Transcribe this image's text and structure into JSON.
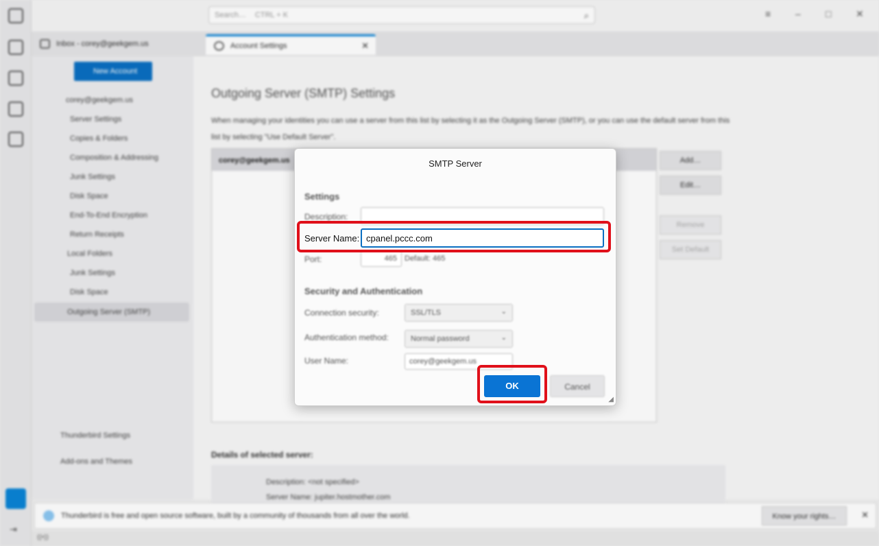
{
  "titlebar": {
    "search_placeholder": "Search…",
    "search_shortcut": "CTRL + K"
  },
  "tabs": [
    {
      "label": "Inbox - corey@geekgem.us"
    },
    {
      "label": "Account Settings"
    }
  ],
  "account_sidebar": {
    "new_account": "New Account",
    "account": "corey@geekgem.us",
    "items": [
      "Server Settings",
      "Copies & Folders",
      "Composition & Addressing",
      "Junk Settings",
      "Disk Space",
      "End-To-End Encryption",
      "Return Receipts"
    ],
    "local_folders": "Local Folders",
    "local_items": [
      "Junk Settings",
      "Disk Space"
    ],
    "outgoing_server": "Outgoing Server (SMTP)",
    "thunderbird_settings": "Thunderbird Settings",
    "addons": "Add-ons and Themes"
  },
  "main": {
    "title": "Outgoing Server (SMTP) Settings",
    "description": "When managing your identities you can use a server from this list by selecting it as the Outgoing Server (SMTP), or you can use the default server from this list by selecting \"Use Default Server\".",
    "list_row": "corey@geekgem.us",
    "buttons": {
      "add": "Add…",
      "edit": "Edit…",
      "remove": "Remove",
      "set_default": "Set Default"
    },
    "details_heading": "Details of selected server:",
    "details_description": "Description: <not specified>",
    "details_server": "Server Name: jupiter.hostmother.com"
  },
  "notification": {
    "text": "Thunderbird is free and open source software, built by a community of thousands from all over the world.",
    "button": "Know your rights…"
  },
  "dialog": {
    "title": "SMTP Server",
    "settings_heading": "Settings",
    "description_label": "Description:",
    "description_value": "",
    "server_name_label": "Server Name:",
    "server_name_value": "cpanel.pccc.com",
    "port_label": "Port:",
    "port_value": "465",
    "port_default": "Default: 465",
    "security_heading": "Security and Authentication",
    "connection_security_label": "Connection security:",
    "connection_security_value": "SSL/TLS",
    "auth_method_label": "Authentication method:",
    "auth_method_value": "Normal password",
    "username_label": "User Name:",
    "username_value": "corey@geekgem.us",
    "ok": "OK",
    "cancel": "Cancel"
  },
  "highlight_color": "#e0101a",
  "accent_color": "#0a74d4"
}
